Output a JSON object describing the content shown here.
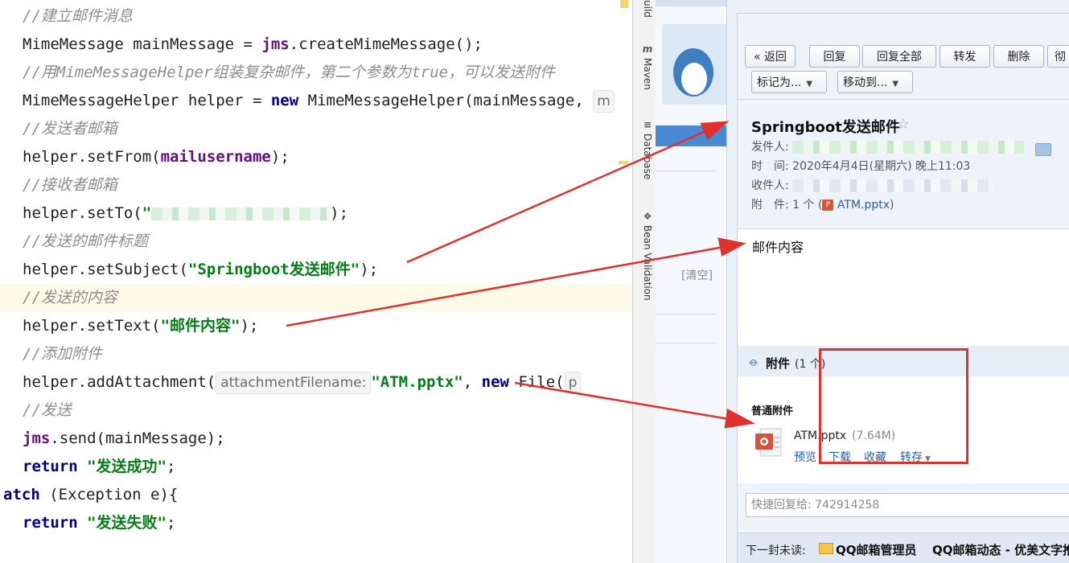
{
  "editor": {
    "lines": [
      {
        "comment": "//建立邮件消息"
      },
      {
        "var_decl": "MimeMessage mainMessage = ",
        "obj": "jms",
        "call": ".createMimeMessage();"
      },
      {
        "comment": "//用MimeMessageHelper组装复杂邮件，第二个参数为true，可以发送附件"
      },
      {
        "var_decl": "MimeMessageHelper helper = ",
        "kw": "new",
        "rest": " MimeMessageHelper(mainMessage, ",
        "cut": "m"
      },
      {
        "comment": "//发送者邮箱"
      },
      {
        "prefix": "helper.setFrom(",
        "field": "mailusername",
        "suffix": ");"
      },
      {
        "comment": "//接收者邮箱"
      },
      {
        "prefix": "helper.setTo(",
        "quote": "\"",
        "suffix": ");"
      },
      {
        "comment": "//发送的邮件标题"
      },
      {
        "prefix": "helper.setSubject(",
        "string": "\"Springboot发送邮件\"",
        "suffix": ");"
      },
      {
        "comment": "//发送的内容"
      },
      {
        "prefix": "helper.setText(",
        "string": "\"邮件内容\"",
        "suffix": ");"
      },
      {
        "comment": "//添加附件"
      },
      {
        "prefix": "helper.addAttachment(",
        "hint": "attachmentFilename:",
        "string": "\"ATM.pptx\"",
        "mid": ", ",
        "kw": "new",
        "rest": " File(",
        "cut": "p"
      },
      {
        "comment": "//发送"
      },
      {
        "obj": "jms",
        "rest": ".send(mainMessage);"
      },
      {
        "kw": "return",
        "string": "\"发送成功\"",
        "suffix": ";"
      },
      {
        "kw": "atch",
        "rest": " (Exception e){"
      },
      {
        "kw": "return",
        "string": "\"发送失败\"",
        "suffix": ";"
      }
    ]
  },
  "ide_toolstrip": {
    "tabs": [
      "uild",
      "Maven",
      "Database",
      "Bean Validation"
    ]
  },
  "mail_side": {
    "clear_link": "[清空]"
  },
  "mail": {
    "toolbar": {
      "back": "« 返回",
      "reply": "回复",
      "reply_all": "回复全部",
      "forward": "转发",
      "delete": "删除",
      "more_cut": "彻",
      "mark_as": "标记为...",
      "move_to": "移动到..."
    },
    "subject": "Springboot发送邮件",
    "meta": {
      "from_label": "发件人:",
      "time_label": "时　间:",
      "time_value": "2020年4月4日(星期六) 晚上11:03",
      "to_label": "收件人:",
      "attach_label": "附　件:",
      "attach_count": "1 个 (",
      "attach_name": "ATM.pptx",
      "attach_close": ")"
    },
    "body": "邮件内容",
    "attachments": {
      "title": "附件",
      "count": "(1 个)",
      "section": "普通附件",
      "file_name": "ATM.pptx",
      "file_size": "(7.64M)",
      "actions": [
        "预览",
        "下载",
        "收藏",
        "转存"
      ]
    },
    "quick_reply_placeholder": "快捷回复给: 742914258",
    "next": {
      "label": "下一封未读:",
      "sender": "QQ邮箱管理员",
      "subject": "QQ邮箱动态 - 优美文字推"
    }
  },
  "colors": {
    "annotation_red": "#e0312f",
    "comment_gray": "#8c8c8c",
    "keyword_navy": "#000080",
    "string_green": "#067d17",
    "field_purple": "#660e7a",
    "mail_link": "#2d5ea8"
  }
}
